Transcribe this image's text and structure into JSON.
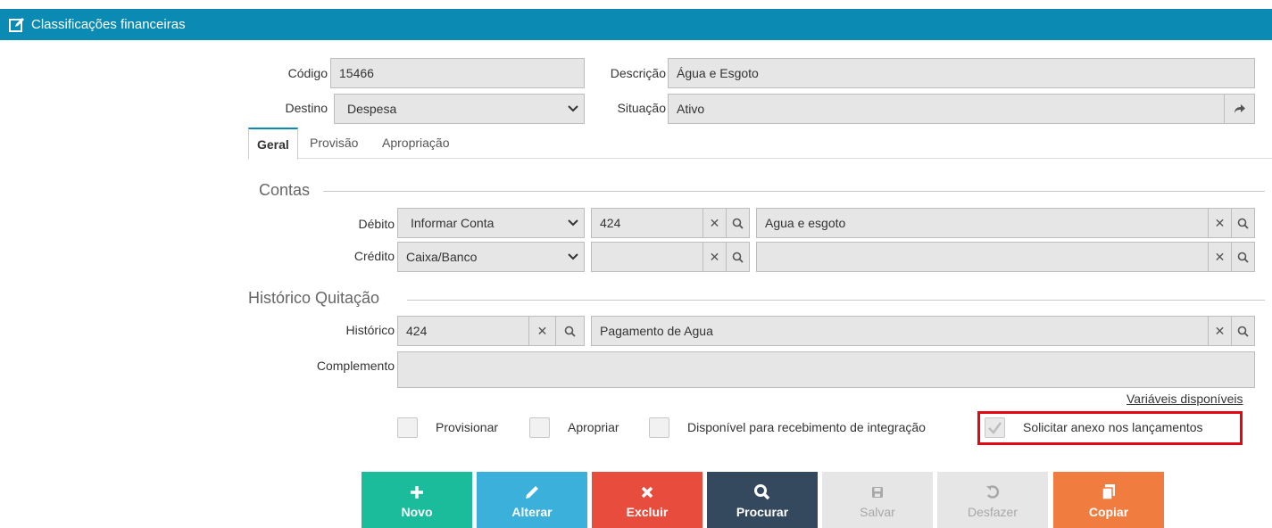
{
  "app": {
    "title": "Classificações financeiras"
  },
  "form": {
    "codigo_label": "Código",
    "codigo_value": "15466",
    "descricao_label": "Descrição",
    "descricao_value": "Água e Esgoto",
    "destino_label": "Destino",
    "destino_value": "Despesa",
    "situacao_label": "Situação",
    "situacao_value": "Ativo"
  },
  "tabs": [
    {
      "label": "Geral",
      "active": true
    },
    {
      "label": "Provisão",
      "active": false
    },
    {
      "label": "Apropriação",
      "active": false
    }
  ],
  "contas": {
    "section_title": "Contas",
    "debito_label": "Débito",
    "debito_tipo": "Informar Conta",
    "debito_codigo": "424",
    "debito_descricao": "Agua e esgoto",
    "credito_label": "Crédito",
    "credito_tipo": "Caixa/Banco",
    "credito_codigo": "",
    "credito_descricao": ""
  },
  "historico": {
    "section_title": "Histórico Quitação",
    "historico_label": "Histórico",
    "historico_codigo": "424",
    "historico_descricao": "Pagamento de Agua",
    "complemento_label": "Complemento",
    "complemento_value": "",
    "variaveis_link": "Variáveis disponíveis"
  },
  "options": {
    "provisionar": {
      "label": "Provisionar",
      "checked": false
    },
    "apropriar": {
      "label": "Apropriar",
      "checked": false
    },
    "integracao": {
      "label": "Disponível para recebimento de integração",
      "checked": false
    },
    "anexo": {
      "label": "Solicitar anexo nos lançamentos",
      "checked": true,
      "disabled": true
    }
  },
  "actions": [
    {
      "label": "Novo",
      "icon": "plus-icon",
      "color": "#1abc9c",
      "enabled": true
    },
    {
      "label": "Alterar",
      "icon": "pencil-icon",
      "color": "#3ab0db",
      "enabled": true
    },
    {
      "label": "Excluir",
      "icon": "close-icon",
      "color": "#e74c3c",
      "enabled": true
    },
    {
      "label": "Procurar",
      "icon": "search-icon",
      "color": "#34495e",
      "enabled": true
    },
    {
      "label": "Salvar",
      "icon": "save-icon",
      "color": "#e6e6e6",
      "enabled": false
    },
    {
      "label": "Desfazer",
      "icon": "undo-icon",
      "color": "#e6e6e6",
      "enabled": false
    },
    {
      "label": "Copiar",
      "icon": "copy-icon",
      "color": "#f07c3f",
      "enabled": true
    }
  ],
  "colors": {
    "header": "#0b8ab3",
    "field_bg": "#e6e6e6",
    "highlight": "#e30613"
  }
}
